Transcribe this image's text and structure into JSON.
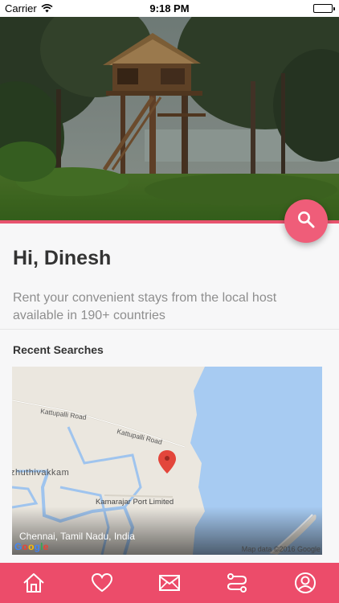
{
  "status_bar": {
    "carrier": "Carrier",
    "time": "9:18 PM"
  },
  "greeting": "Hi, Dinesh",
  "tagline": "Rent your convenient stays from the local host available in 190+ countries",
  "recent_searches": {
    "title": "Recent Searches",
    "location": "Chennai, Tamil Nadu, India",
    "map": {
      "labels": {
        "road1": "Kattupalli Road",
        "road2": "Kattupalli Road",
        "area": "zhuthivakkam",
        "port": "Kamarajar Port Limited"
      },
      "attribution": "Map data ©2016 Google",
      "logo": "Google"
    }
  },
  "colors": {
    "accent": "#ec4c6a",
    "fab": "#ef5d79",
    "water": "#a7cbf2"
  },
  "tabs": [
    {
      "name": "home",
      "icon": "home-icon"
    },
    {
      "name": "favorites",
      "icon": "heart-icon"
    },
    {
      "name": "messages",
      "icon": "envelope-icon"
    },
    {
      "name": "trips",
      "icon": "route-icon"
    },
    {
      "name": "profile",
      "icon": "user-icon"
    }
  ]
}
